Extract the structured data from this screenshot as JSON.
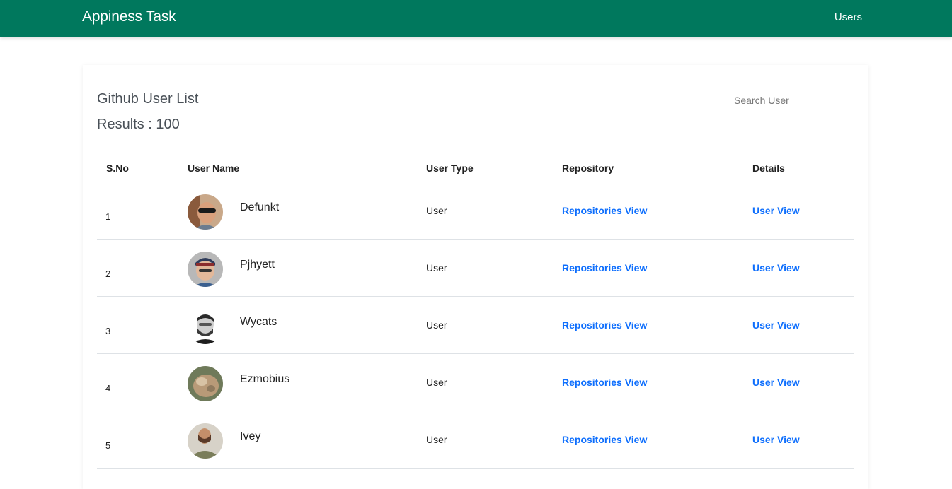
{
  "navbar": {
    "brand": "Appiness Task",
    "users_link": "Users",
    "color": "#00785d"
  },
  "page": {
    "title": "Github User List",
    "results": "Results : 100",
    "search_placeholder": "Search User"
  },
  "table": {
    "headers": {
      "sno": "S.No",
      "username": "User Name",
      "usertype": "User Type",
      "repository": "Repository",
      "details": "Details"
    },
    "rows": [
      {
        "sno": "1",
        "name": "Defunkt",
        "type": "User",
        "repo": "Repositories View",
        "details": "User View"
      },
      {
        "sno": "2",
        "name": "Pjhyett",
        "type": "User",
        "repo": "Repositories View",
        "details": "User View"
      },
      {
        "sno": "3",
        "name": "Wycats",
        "type": "User",
        "repo": "Repositories View",
        "details": "User View"
      },
      {
        "sno": "4",
        "name": "Ezmobius",
        "type": "User",
        "repo": "Repositories View",
        "details": "User View"
      },
      {
        "sno": "5",
        "name": "Ivey",
        "type": "User",
        "repo": "Repositories View",
        "details": "User View"
      }
    ]
  },
  "colors": {
    "link": "#0d6efd",
    "heading": "#495057"
  }
}
